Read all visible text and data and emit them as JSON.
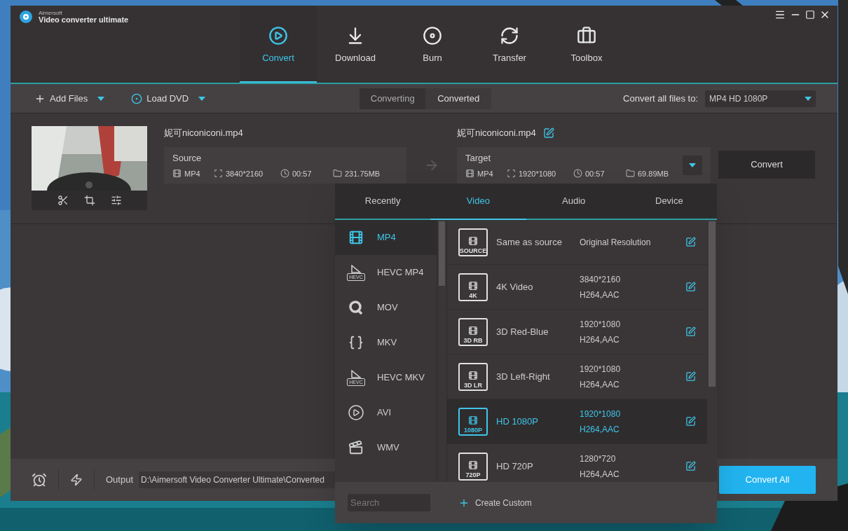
{
  "app": {
    "brand": "Aimersoft",
    "product": "Video converter ultimate"
  },
  "nav_tabs": [
    {
      "label": "Convert",
      "kind": "convert",
      "selected": true
    },
    {
      "label": "Download",
      "kind": "download",
      "selected": false
    },
    {
      "label": "Burn",
      "kind": "burn",
      "selected": false
    },
    {
      "label": "Transfer",
      "kind": "transfer",
      "selected": false
    },
    {
      "label": "Toolbox",
      "kind": "toolbox",
      "selected": false
    }
  ],
  "toolbar": {
    "add_files": "Add Files",
    "load_dvd": "Load DVD",
    "view_tabs": [
      {
        "label": "Converting",
        "selected": true
      },
      {
        "label": "Converted",
        "selected": false
      }
    ],
    "convert_all_label": "Convert all files to:",
    "format_select": "MP4 HD 1080P"
  },
  "file": {
    "source_name": "妮可niconiconi.mp4",
    "target_name": "妮可niconiconi.mp4",
    "source": {
      "label": "Source",
      "format": "MP4",
      "resolution": "3840*2160",
      "duration": "00:57",
      "size": "231.75MB"
    },
    "target": {
      "label": "Target",
      "format": "MP4",
      "resolution": "1920*1080",
      "duration": "00:57",
      "size": "69.89MB"
    },
    "convert_button": "Convert"
  },
  "format_popup": {
    "tabs": [
      {
        "label": "Recently",
        "selected": false
      },
      {
        "label": "Video",
        "selected": true
      },
      {
        "label": "Audio",
        "selected": false
      },
      {
        "label": "Device",
        "selected": false
      }
    ],
    "formats": [
      {
        "label": "MP4",
        "kind": "film",
        "selected": true
      },
      {
        "label": "HEVC MP4",
        "kind": "hevc",
        "badge": "HEVC",
        "selected": false
      },
      {
        "label": "MOV",
        "kind": "q",
        "selected": false
      },
      {
        "label": "MKV",
        "kind": "braces",
        "selected": false
      },
      {
        "label": "HEVC MKV",
        "kind": "hevc",
        "badge": "HEVC",
        "selected": false
      },
      {
        "label": "AVI",
        "kind": "play",
        "selected": false
      },
      {
        "label": "WMV",
        "kind": "clapper",
        "selected": false
      }
    ],
    "presets": [
      {
        "name": "Same as source",
        "badge": "SOURCE",
        "detail": [
          "Original Resolution"
        ],
        "selected": false
      },
      {
        "name": "4K Video",
        "badge": "4K",
        "detail": [
          "3840*2160",
          "H264,AAC"
        ],
        "selected": false
      },
      {
        "name": "3D Red-Blue",
        "badge": "3D RB",
        "detail": [
          "1920*1080",
          "H264,AAC"
        ],
        "selected": false
      },
      {
        "name": "3D Left-Right",
        "badge": "3D LR",
        "detail": [
          "1920*1080",
          "H264,AAC"
        ],
        "selected": false
      },
      {
        "name": "HD 1080P",
        "badge": "1080P",
        "detail": [
          "1920*1080",
          "H264,AAC"
        ],
        "selected": true
      },
      {
        "name": "HD 720P",
        "badge": "720P",
        "detail": [
          "1280*720",
          "H264,AAC"
        ],
        "selected": false
      }
    ],
    "search": {
      "placeholder": "Search"
    },
    "create_custom": "Create Custom"
  },
  "bottom_bar": {
    "output_label": "Output",
    "output_path": "D:\\Aimersoft Video Converter Ultimate\\Converted",
    "convert_all_button": "Convert All"
  }
}
